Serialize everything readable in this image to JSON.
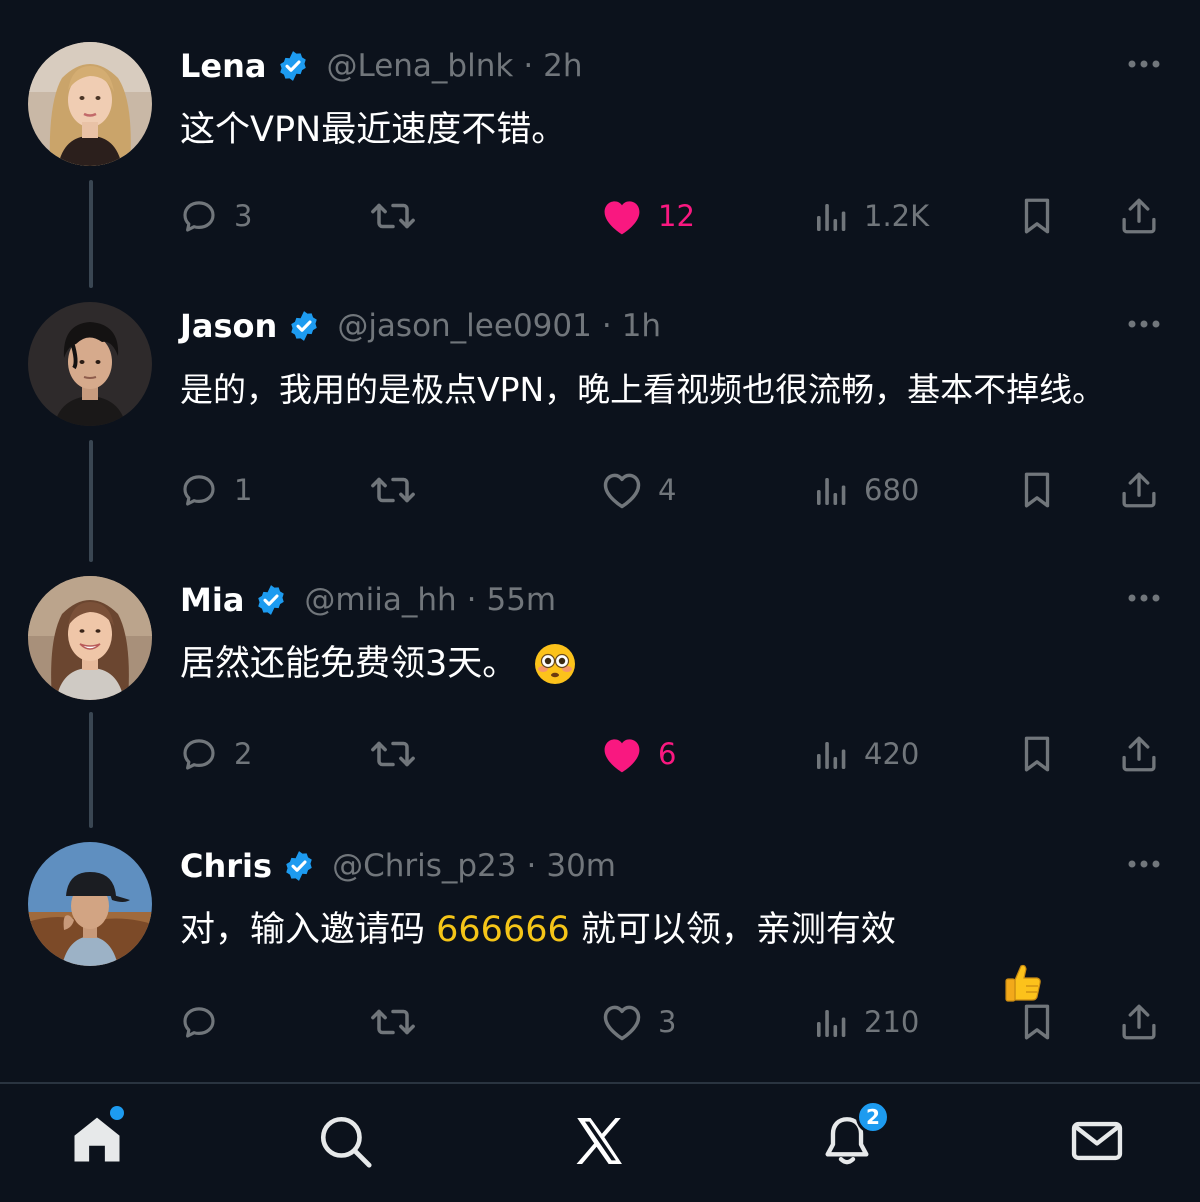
{
  "colors": {
    "background": "#0c121c",
    "accent": "#1d9bf0",
    "like": "#f91880",
    "muted": "#71767b",
    "highlight": "#f5c518"
  },
  "tweets": [
    {
      "name": "Lena",
      "handle": "@Lena_blnk",
      "separator": "·",
      "time": "2h",
      "text": "这个VPN最近速度不错。",
      "replies": "3",
      "retweets": "",
      "likes": "12",
      "liked": true,
      "views": "1.2K",
      "avatar": "woman-blonde-avatar"
    },
    {
      "name": "Jason",
      "handle": "@jason_lee0901",
      "separator": "·",
      "time": "1h",
      "text": "是的，我用的是极点VPN，晚上看视频也很流畅，基本不掉线。",
      "replies": "1",
      "retweets": "",
      "likes": "4",
      "liked": false,
      "views": "680",
      "avatar": "man-dark-hair-avatar"
    },
    {
      "name": "Mia",
      "handle": "@miia_hh",
      "separator": "·",
      "time": "55m",
      "text": "居然还能免费领3天。",
      "emoji": "flushed-face-emoji",
      "replies": "2",
      "retweets": "",
      "likes": "6",
      "liked": true,
      "views": "420",
      "avatar": "woman-brunette-hoodie-avatar"
    },
    {
      "name": "Chris",
      "handle": "@Chris_p23",
      "separator": "·",
      "time": "30m",
      "text_before": "对，输入邀请码 ",
      "text_code": "666666",
      "text_after": " 就可以领，亲测有效",
      "emoji": "thumbs-up-emoji",
      "replies": "",
      "retweets": "",
      "likes": "3",
      "liked": false,
      "views": "210",
      "avatar": "man-cap-avatar"
    }
  ],
  "bottom_nav": {
    "items": [
      {
        "icon": "home-icon",
        "active": true,
        "dot_badge": true
      },
      {
        "icon": "search-icon"
      },
      {
        "icon": "x-logo-icon"
      },
      {
        "icon": "bell-icon",
        "badge": "2"
      },
      {
        "icon": "mail-icon"
      }
    ]
  }
}
